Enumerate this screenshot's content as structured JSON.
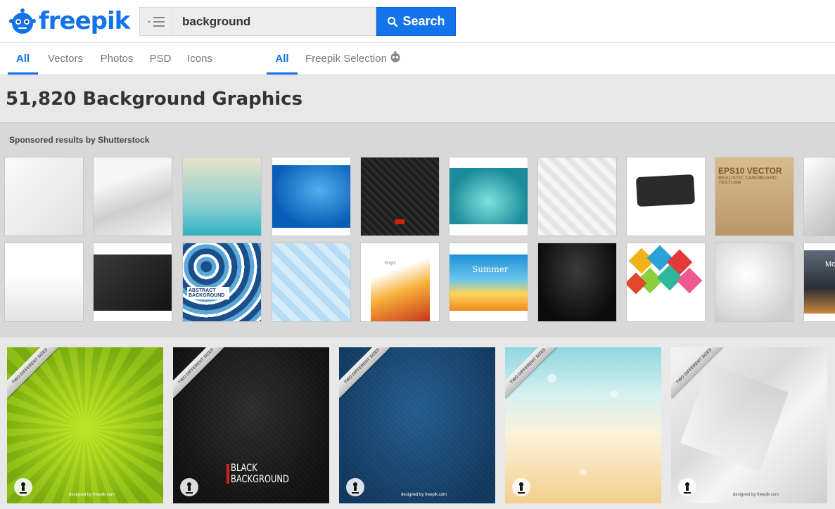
{
  "brand": {
    "name": "freepik",
    "color": "#1273eb"
  },
  "search": {
    "value": "background",
    "button_label": "Search",
    "menu_icon": "menu-icon"
  },
  "tabs_left": [
    "All",
    "Vectors",
    "Photos",
    "PSD",
    "Icons"
  ],
  "tabs_right": [
    "All",
    "Freepik Selection"
  ],
  "page_title": "51,820 Background Graphics",
  "sponsored": {
    "label": "Sponsored results by Shutterstock"
  },
  "thumb_texts": {
    "eps": "EPS10 VECTOR",
    "eps_sub": "REALISTIC CARDBOARD TEXTURE",
    "abstract": "ABSTRACT BACKGROUND",
    "summer": "Summer",
    "bright": "Bright",
    "mo": "Mo"
  },
  "results": {
    "ribbon_text": "TWO DIFFERENT SIZES",
    "credit": "designed by freepik.com",
    "black_bg_line1": "BLACK",
    "black_bg_line2": "BACKGROUND"
  }
}
